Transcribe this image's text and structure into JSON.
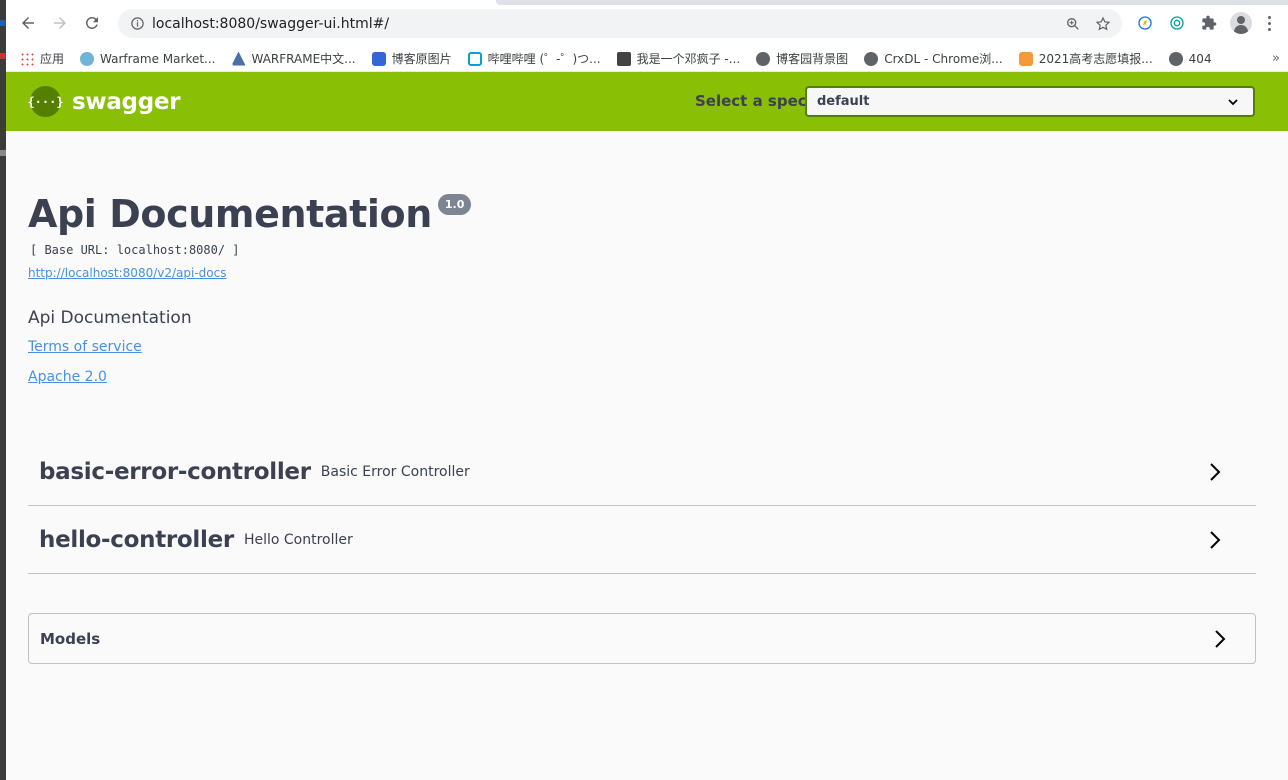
{
  "browser": {
    "url": "localhost:8080/swagger-ui.html#/",
    "icons": [
      "back-icon",
      "forward-icon",
      "reload-icon",
      "info-icon",
      "zoom-icon",
      "star-icon",
      "extension-icon",
      "profile-icon",
      "menu-icon"
    ]
  },
  "bookmarks": {
    "items": [
      {
        "label": "应用",
        "color": "#ea4335"
      },
      {
        "label": "Warframe Market...",
        "color": "#6fb4d9"
      },
      {
        "label": "WARFRAME中文...",
        "color": "#4a6fa5"
      },
      {
        "label": "博客原图片",
        "color": "#3367d6"
      },
      {
        "label": "哔哩哔哩 (゜-゜)つ...",
        "color": "#00a1d6"
      },
      {
        "label": "我是一个邓疯子 -...",
        "color": "#444444"
      },
      {
        "label": "博客园背景图",
        "color": "#5f6368"
      },
      {
        "label": "CrxDL - Chrome浏...",
        "color": "#5f6368"
      },
      {
        "label": "2021高考志愿填报...",
        "color": "#f29b38"
      },
      {
        "label": "404",
        "color": "#5f6368"
      }
    ],
    "more": "»"
  },
  "swagger": {
    "brand": "swagger",
    "logo_glyph": "{···}",
    "spec_label": "Select a spec",
    "spec_value": "default",
    "colors": {
      "header": "#89bf04",
      "logo": "#547f00",
      "link": "#4990e2",
      "text": "#3b4151"
    }
  },
  "info": {
    "title": "Api Documentation",
    "version": "1.0",
    "base_url": "[ Base URL: localhost:8080/ ]",
    "docs_url": "http://localhost:8080/v2/api-docs",
    "description": "Api Documentation",
    "terms": "Terms of service",
    "license": "Apache 2.0"
  },
  "tags": [
    {
      "name": "basic-error-controller",
      "description": "Basic Error Controller"
    },
    {
      "name": "hello-controller",
      "description": "Hello Controller"
    }
  ],
  "models": {
    "title": "Models"
  }
}
